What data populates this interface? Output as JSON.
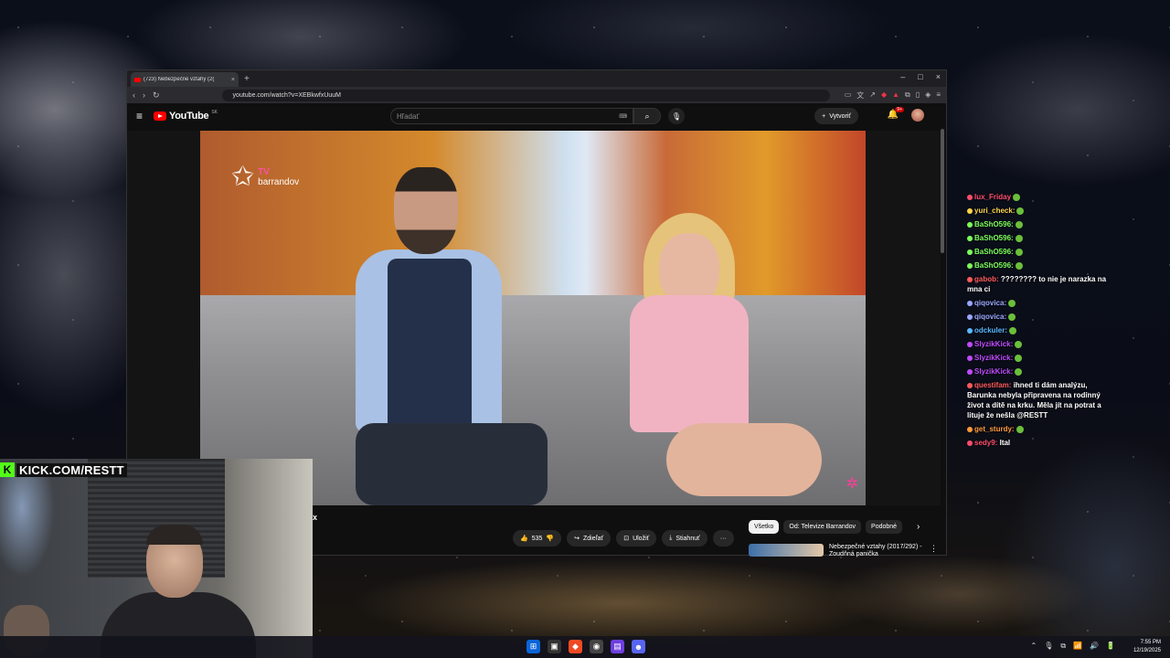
{
  "browser": {
    "tab_title": "(723) Nebezpečné vztahy (2(",
    "tab_close": "×",
    "new_tab": "+",
    "window_controls": [
      "–",
      "□",
      "×"
    ],
    "nav": [
      "‹",
      "›",
      "↻"
    ],
    "url": "youtube.com/watch?v=XEBkwfxUuuM"
  },
  "youtube": {
    "menu_icon": "≡",
    "logo_text": "YouTube",
    "logo_region": "SK",
    "search_placeholder": "Hľadať",
    "keyboard_icon": "⌨",
    "search_icon": "⌕",
    "mic_icon": "🎙",
    "create_label": "Vytvoriť",
    "notifications_badge": "9+",
    "bell_icon": "🔔"
  },
  "video": {
    "channel_logo_line1": "TV",
    "channel_logo_line2": "barrandov",
    "title_fragment": "x",
    "like_count": "535",
    "share_label": "Zdieľať",
    "save_label": "Uložiť",
    "download_label": "Stiahnuť",
    "more": "···"
  },
  "chips": [
    {
      "label": "Všetko",
      "active": true
    },
    {
      "label": "Od: Televize Barrandov",
      "active": false
    },
    {
      "label": "Podobné",
      "active": false
    }
  ],
  "chip_next": "›",
  "recommendation": {
    "title": "Nebezpečné vztahy (2017/292) - Zoudňná panička",
    "menu": "⋮"
  },
  "kick": {
    "logo": "K",
    "url": "KICK.COM/RESTT"
  },
  "chat": [
    {
      "user": "lux_Friday",
      "text": "",
      "color": "#ff4d6d"
    },
    {
      "user": "yuri_check:",
      "text": "",
      "color": "#ffd54a"
    },
    {
      "user": "BaShO596:",
      "text": "",
      "color": "#7dff5b"
    },
    {
      "user": "BaShO596:",
      "text": "",
      "color": "#7dff5b"
    },
    {
      "user": "BaShO596:",
      "text": "",
      "color": "#7dff5b"
    },
    {
      "user": "BaShO596:",
      "text": "",
      "color": "#7dff5b"
    },
    {
      "user": "gabob:",
      "text": "???????? to nie je narazka na mna ci",
      "color": "#ff5b5b"
    },
    {
      "user": "qiqovica:",
      "text": "",
      "color": "#9aa7ff"
    },
    {
      "user": "qiqovica:",
      "text": "",
      "color": "#9aa7ff"
    },
    {
      "user": "odckuler:",
      "text": "",
      "color": "#5bb8ff"
    },
    {
      "user": "SlyzikKick:",
      "text": "",
      "color": "#c04bff"
    },
    {
      "user": "SlyzikKick:",
      "text": "",
      "color": "#c04bff"
    },
    {
      "user": "SlyzikKick:",
      "text": "",
      "color": "#c04bff"
    },
    {
      "user": "questifam:",
      "text": "ihned ti dám analýzu, Barunka nebyla připravena na rodinný život a dítě na krku. Měla jít na potrat a lituje že nešla @RESTT",
      "color": "#ff5b5b"
    },
    {
      "user": "get_sturdy:",
      "text": "",
      "color": "#ff9a3d"
    },
    {
      "user": "sedy9:",
      "text": "Ital",
      "color": "#ff4d6d"
    }
  ],
  "taskbar": {
    "time": "7:55 PM",
    "date": "12/19/2025",
    "tray": [
      "⌃",
      "🎙",
      "⧉",
      "📶",
      "🔊",
      "🔋"
    ]
  }
}
